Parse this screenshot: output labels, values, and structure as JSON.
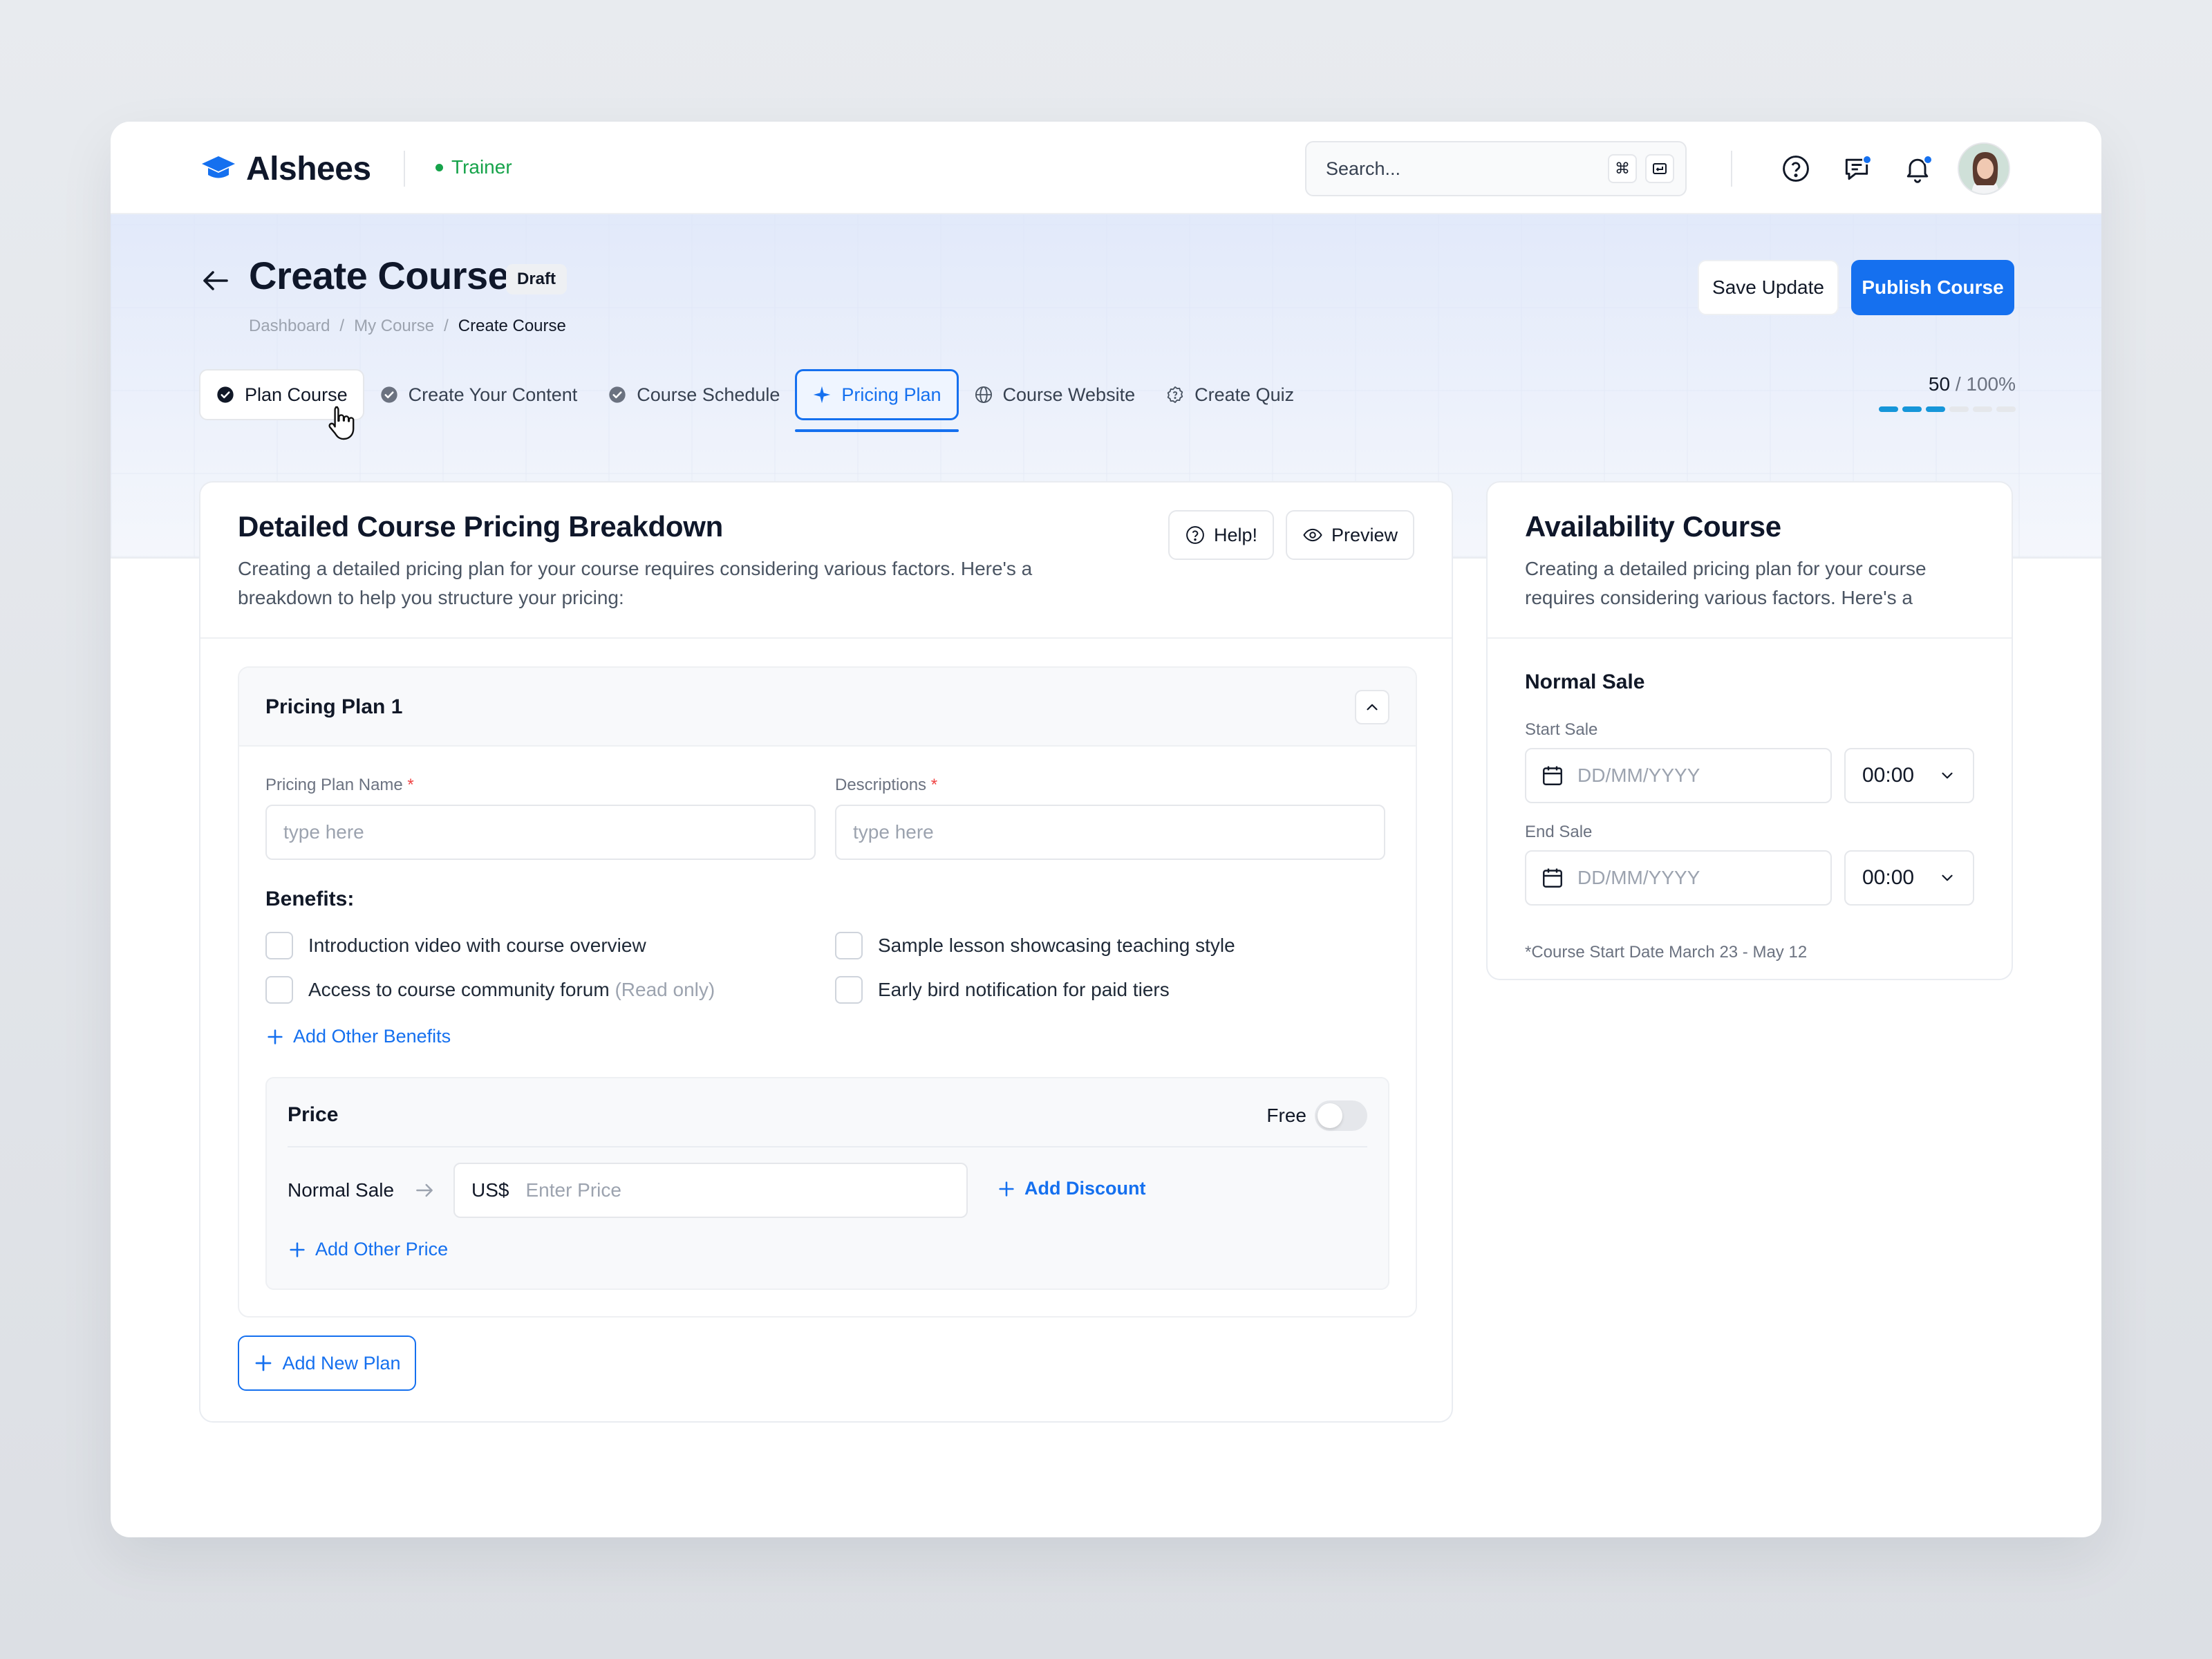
{
  "app": {
    "name": "Alshees",
    "role": "Trainer",
    "colors": {
      "primary": "#1570ef",
      "role_green": "#16a34a",
      "progress": "#1696d9"
    }
  },
  "search": {
    "placeholder": "Search...",
    "shortcut_icon": "command-icon",
    "enter_icon": "enter-key-icon"
  },
  "header_icons": [
    "help-circle-icon",
    "chat-icon",
    "bell-icon"
  ],
  "page": {
    "title": "Create Course",
    "status": "Draft",
    "breadcrumbs": [
      "Dashboard",
      "My Course",
      "Create Course"
    ],
    "breadcrumb_sep": "/",
    "actions": {
      "save": "Save Update",
      "publish": "Publish Course"
    }
  },
  "tabs": [
    {
      "label": "Plan Course",
      "icon": "check-circle-icon",
      "state": "done"
    },
    {
      "label": "Create Your Content",
      "icon": "check-circle-icon",
      "state": "done"
    },
    {
      "label": "Course Schedule",
      "icon": "check-circle-icon",
      "state": "done"
    },
    {
      "label": "Pricing Plan",
      "icon": "sparkle-icon",
      "state": "current"
    },
    {
      "label": "Course Website",
      "icon": "globe-icon",
      "state": "todo"
    },
    {
      "label": "Create Quiz",
      "icon": "question-badge-icon",
      "state": "todo"
    }
  ],
  "progress": {
    "value": "50",
    "total": "/ 100%",
    "segments_filled": 3,
    "segments_total": 6
  },
  "pricing": {
    "title": "Detailed Course Pricing Breakdown",
    "description": "Creating a detailed pricing plan for your course requires considering various factors. Here's a breakdown to help you structure your pricing:",
    "help": "Help!",
    "preview": "Preview",
    "plan": {
      "title": "Pricing Plan 1",
      "name_label": "Pricing Plan Name",
      "name_placeholder": "type here",
      "desc_label": "Descriptions",
      "desc_placeholder": "type here",
      "required_mark": "*",
      "benefits_title": "Benefits:",
      "benefits": [
        {
          "label": "Introduction video with course overview",
          "note": "",
          "checked": false
        },
        {
          "label": "Sample lesson showcasing teaching style",
          "note": "",
          "checked": false
        },
        {
          "label": "Access to course community forum",
          "note": "(Read only)",
          "checked": false
        },
        {
          "label": "Early bird notification for paid tiers",
          "note": "",
          "checked": false
        }
      ],
      "add_benefit": "Add Other Benefits",
      "price": {
        "title": "Price",
        "free_label": "Free",
        "free_on": false,
        "sale_label": "Normal Sale",
        "currency": "US$",
        "placeholder": "Enter Price",
        "add_discount": "Add Discount",
        "add_price": "Add Other Price"
      }
    },
    "add_plan": "Add New Plan"
  },
  "availability": {
    "title": "Availability Course",
    "description": "Creating a detailed pricing plan for your course requires considering various factors. Here's a",
    "section": "Normal Sale",
    "start_label": "Start Sale",
    "end_label": "End Sale",
    "date_placeholder": "DD/MM/YYYY",
    "start_time": "00:00",
    "end_time": "00:00",
    "note": "*Course Start Date March 23 - May 12"
  }
}
